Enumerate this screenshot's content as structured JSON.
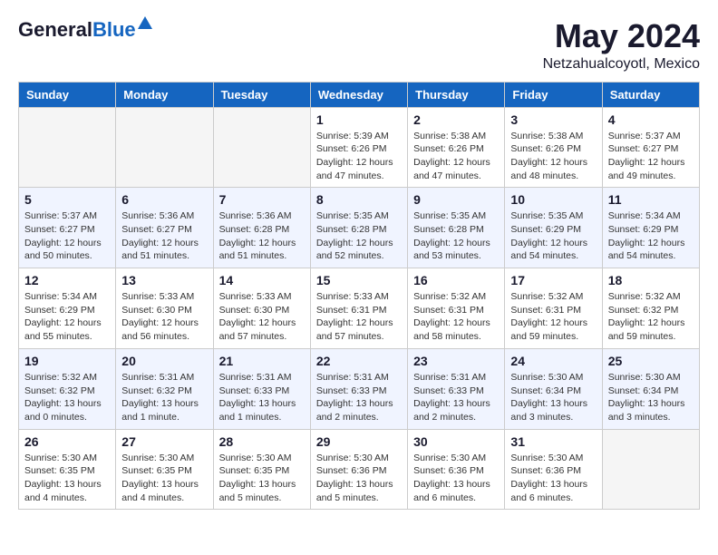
{
  "header": {
    "logo_general": "General",
    "logo_blue": "Blue",
    "month_year": "May 2024",
    "location": "Netzahualcoyotl, Mexico"
  },
  "weekdays": [
    "Sunday",
    "Monday",
    "Tuesday",
    "Wednesday",
    "Thursday",
    "Friday",
    "Saturday"
  ],
  "weeks": [
    [
      {
        "day": "",
        "empty": true
      },
      {
        "day": "",
        "empty": true
      },
      {
        "day": "",
        "empty": true
      },
      {
        "day": "1",
        "sunrise": "5:39 AM",
        "sunset": "6:26 PM",
        "daylight": "12 hours and 47 minutes."
      },
      {
        "day": "2",
        "sunrise": "5:38 AM",
        "sunset": "6:26 PM",
        "daylight": "12 hours and 47 minutes."
      },
      {
        "day": "3",
        "sunrise": "5:38 AM",
        "sunset": "6:26 PM",
        "daylight": "12 hours and 48 minutes."
      },
      {
        "day": "4",
        "sunrise": "5:37 AM",
        "sunset": "6:27 PM",
        "daylight": "12 hours and 49 minutes."
      }
    ],
    [
      {
        "day": "5",
        "sunrise": "5:37 AM",
        "sunset": "6:27 PM",
        "daylight": "12 hours and 50 minutes."
      },
      {
        "day": "6",
        "sunrise": "5:36 AM",
        "sunset": "6:27 PM",
        "daylight": "12 hours and 51 minutes."
      },
      {
        "day": "7",
        "sunrise": "5:36 AM",
        "sunset": "6:28 PM",
        "daylight": "12 hours and 51 minutes."
      },
      {
        "day": "8",
        "sunrise": "5:35 AM",
        "sunset": "6:28 PM",
        "daylight": "12 hours and 52 minutes."
      },
      {
        "day": "9",
        "sunrise": "5:35 AM",
        "sunset": "6:28 PM",
        "daylight": "12 hours and 53 minutes."
      },
      {
        "day": "10",
        "sunrise": "5:35 AM",
        "sunset": "6:29 PM",
        "daylight": "12 hours and 54 minutes."
      },
      {
        "day": "11",
        "sunrise": "5:34 AM",
        "sunset": "6:29 PM",
        "daylight": "12 hours and 54 minutes."
      }
    ],
    [
      {
        "day": "12",
        "sunrise": "5:34 AM",
        "sunset": "6:29 PM",
        "daylight": "12 hours and 55 minutes."
      },
      {
        "day": "13",
        "sunrise": "5:33 AM",
        "sunset": "6:30 PM",
        "daylight": "12 hours and 56 minutes."
      },
      {
        "day": "14",
        "sunrise": "5:33 AM",
        "sunset": "6:30 PM",
        "daylight": "12 hours and 57 minutes."
      },
      {
        "day": "15",
        "sunrise": "5:33 AM",
        "sunset": "6:31 PM",
        "daylight": "12 hours and 57 minutes."
      },
      {
        "day": "16",
        "sunrise": "5:32 AM",
        "sunset": "6:31 PM",
        "daylight": "12 hours and 58 minutes."
      },
      {
        "day": "17",
        "sunrise": "5:32 AM",
        "sunset": "6:31 PM",
        "daylight": "12 hours and 59 minutes."
      },
      {
        "day": "18",
        "sunrise": "5:32 AM",
        "sunset": "6:32 PM",
        "daylight": "12 hours and 59 minutes."
      }
    ],
    [
      {
        "day": "19",
        "sunrise": "5:32 AM",
        "sunset": "6:32 PM",
        "daylight": "13 hours and 0 minutes."
      },
      {
        "day": "20",
        "sunrise": "5:31 AM",
        "sunset": "6:32 PM",
        "daylight": "13 hours and 1 minute."
      },
      {
        "day": "21",
        "sunrise": "5:31 AM",
        "sunset": "6:33 PM",
        "daylight": "13 hours and 1 minutes."
      },
      {
        "day": "22",
        "sunrise": "5:31 AM",
        "sunset": "6:33 PM",
        "daylight": "13 hours and 2 minutes."
      },
      {
        "day": "23",
        "sunrise": "5:31 AM",
        "sunset": "6:33 PM",
        "daylight": "13 hours and 2 minutes."
      },
      {
        "day": "24",
        "sunrise": "5:30 AM",
        "sunset": "6:34 PM",
        "daylight": "13 hours and 3 minutes."
      },
      {
        "day": "25",
        "sunrise": "5:30 AM",
        "sunset": "6:34 PM",
        "daylight": "13 hours and 3 minutes."
      }
    ],
    [
      {
        "day": "26",
        "sunrise": "5:30 AM",
        "sunset": "6:35 PM",
        "daylight": "13 hours and 4 minutes."
      },
      {
        "day": "27",
        "sunrise": "5:30 AM",
        "sunset": "6:35 PM",
        "daylight": "13 hours and 4 minutes."
      },
      {
        "day": "28",
        "sunrise": "5:30 AM",
        "sunset": "6:35 PM",
        "daylight": "13 hours and 5 minutes."
      },
      {
        "day": "29",
        "sunrise": "5:30 AM",
        "sunset": "6:36 PM",
        "daylight": "13 hours and 5 minutes."
      },
      {
        "day": "30",
        "sunrise": "5:30 AM",
        "sunset": "6:36 PM",
        "daylight": "13 hours and 6 minutes."
      },
      {
        "day": "31",
        "sunrise": "5:30 AM",
        "sunset": "6:36 PM",
        "daylight": "13 hours and 6 minutes."
      },
      {
        "day": "",
        "empty": true
      }
    ]
  ]
}
